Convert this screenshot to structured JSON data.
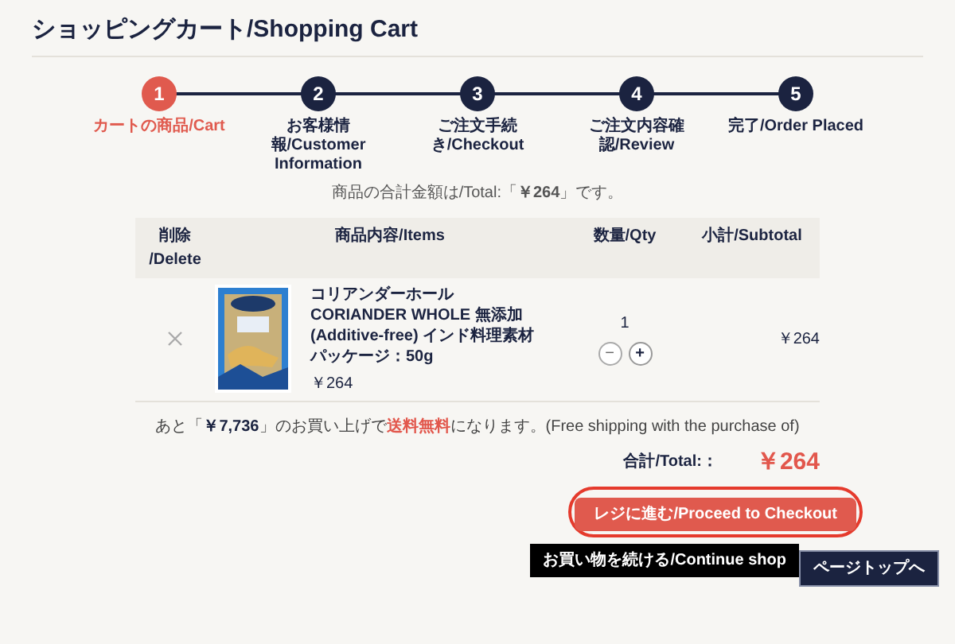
{
  "page_title": "ショッピングカート/Shopping Cart",
  "steps": [
    {
      "number": "1",
      "label": "カートの商品/Cart",
      "selected": true
    },
    {
      "number": "2",
      "label": "お客様情報/Customer Information",
      "selected": false
    },
    {
      "number": "3",
      "label": "ご注文手続き/Checkout",
      "selected": false
    },
    {
      "number": "4",
      "label": "ご注文内容確認/Review",
      "selected": false
    },
    {
      "number": "5",
      "label": "完了/Order Placed",
      "selected": false
    }
  ],
  "total_summary": "商品の合計金額は/Total:「**￥264**」です。",
  "table": {
    "columns": [
      "削除 /Delete",
      "商品内容/Items",
      "数量/Qty",
      "小計/Subtotal"
    ],
    "rows": [
      {
        "name": "コリアンダーホール CORIANDER WHOLE 無添加(Additive-free) インド料理素材",
        "package": "パッケージ：50g",
        "price": "￥264",
        "qty": "1",
        "decrease": "−",
        "increase": "+",
        "subtotal": "￥264"
      }
    ]
  },
  "free_shipping": [
    {
      "text": "あと「",
      "kind": "plain"
    },
    {
      "text": "￥7,736",
      "kind": "strong"
    },
    {
      "text": "」のお買い上げで",
      "kind": "plain"
    },
    {
      "text": "送料無料",
      "kind": "alert"
    },
    {
      "text": "になります。(Free shipping with the purchase of)",
      "kind": "plain"
    }
  ],
  "total": {
    "label": "合計/Total:：",
    "value": "￥264"
  },
  "buttons": {
    "checkout": "レジに進む/Proceed to Checkout",
    "continue": "お買い物を続ける/Continue shop",
    "page_top": "ページトップへ"
  }
}
